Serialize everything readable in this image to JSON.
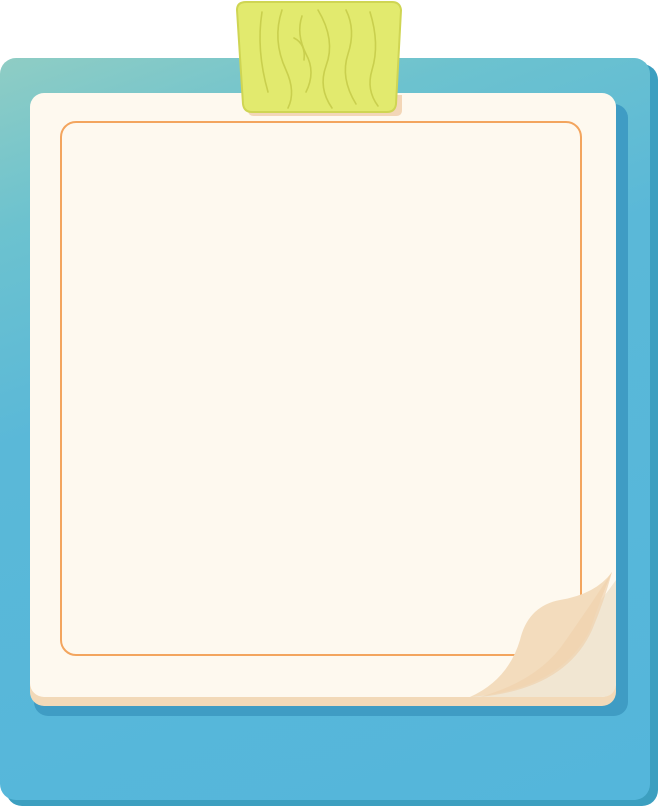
{
  "colors": {
    "board": "#54b6db",
    "board_shadow": "#3c9fc0",
    "paper": "#fef9ef",
    "paper_edge": "#f2d9b8",
    "frame_border": "#f3a55e",
    "clip": "#e2ea6e",
    "curl": "#f3ddc0"
  },
  "icons": {
    "clip": "wooden-clip-icon",
    "curl": "page-curl-icon"
  }
}
